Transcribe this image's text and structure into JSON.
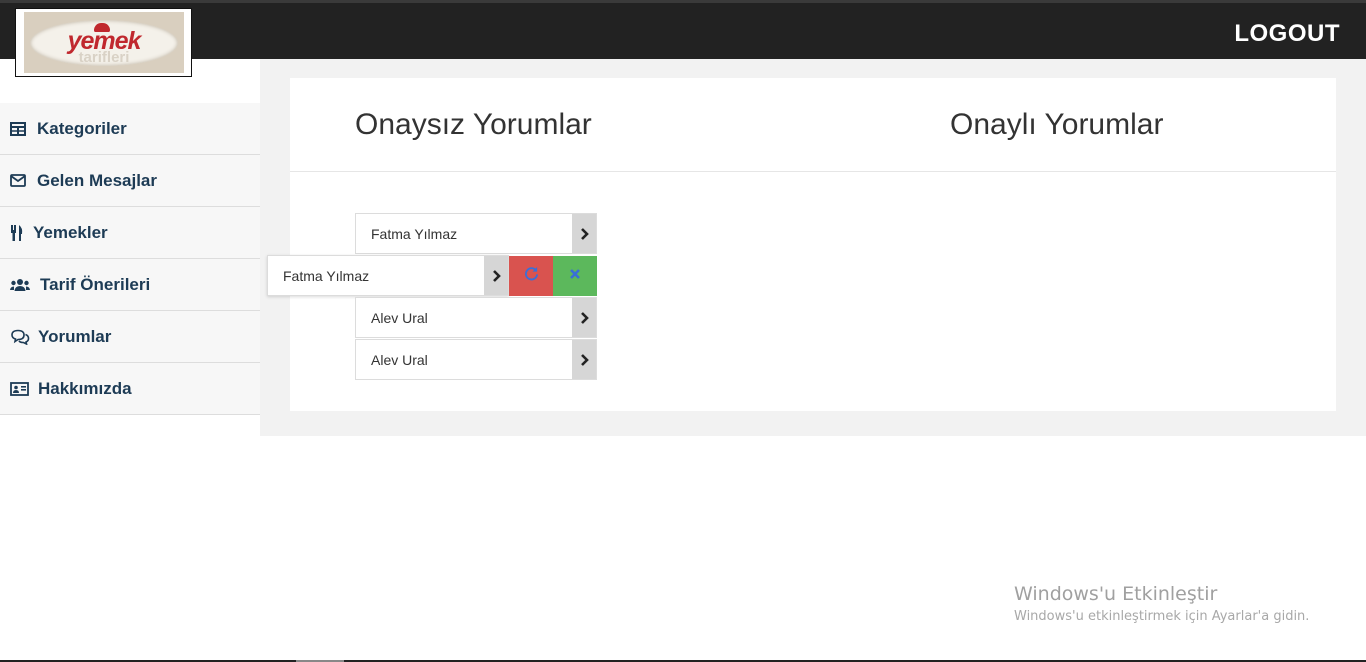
{
  "header": {
    "logo_text_main": "yemek",
    "logo_text_sub": "tarifleri",
    "logout_label": "LOGOUT"
  },
  "sidebar": {
    "items": [
      {
        "label": "Kategoriler",
        "icon": "table-icon"
      },
      {
        "label": "Gelen Mesajlar",
        "icon": "envelope-icon"
      },
      {
        "label": "Yemekler",
        "icon": "utensils-icon"
      },
      {
        "label": "Tarif Önerileri",
        "icon": "users-icon"
      },
      {
        "label": "Yorumlar",
        "icon": "comments-icon"
      },
      {
        "label": "Hakkımızda",
        "icon": "id-card-icon"
      }
    ]
  },
  "main": {
    "unapproved_title": "Onaysız Yorumlar",
    "approved_title": "Onaylı Yorumlar",
    "unapproved_comments": [
      {
        "name": "Fatma Yılmaz"
      },
      {
        "name": "Fatma Yılmaz"
      },
      {
        "name": "Alev Ural"
      },
      {
        "name": "Alev Ural"
      }
    ],
    "actions": {
      "refresh_icon": "refresh-icon",
      "approve_icon": "close-icon"
    }
  },
  "watermark": {
    "title": "Windows'u Etkinleştir",
    "subtitle": "Windows'u etkinleştirmek için Ayarlar'a gidin."
  },
  "colors": {
    "topbar": "#222222",
    "sidebar_text": "#1d3b55",
    "refresh_button": "#d9534f",
    "approve_button": "#5cb85c",
    "arrow_tab": "#d6d6d6"
  }
}
